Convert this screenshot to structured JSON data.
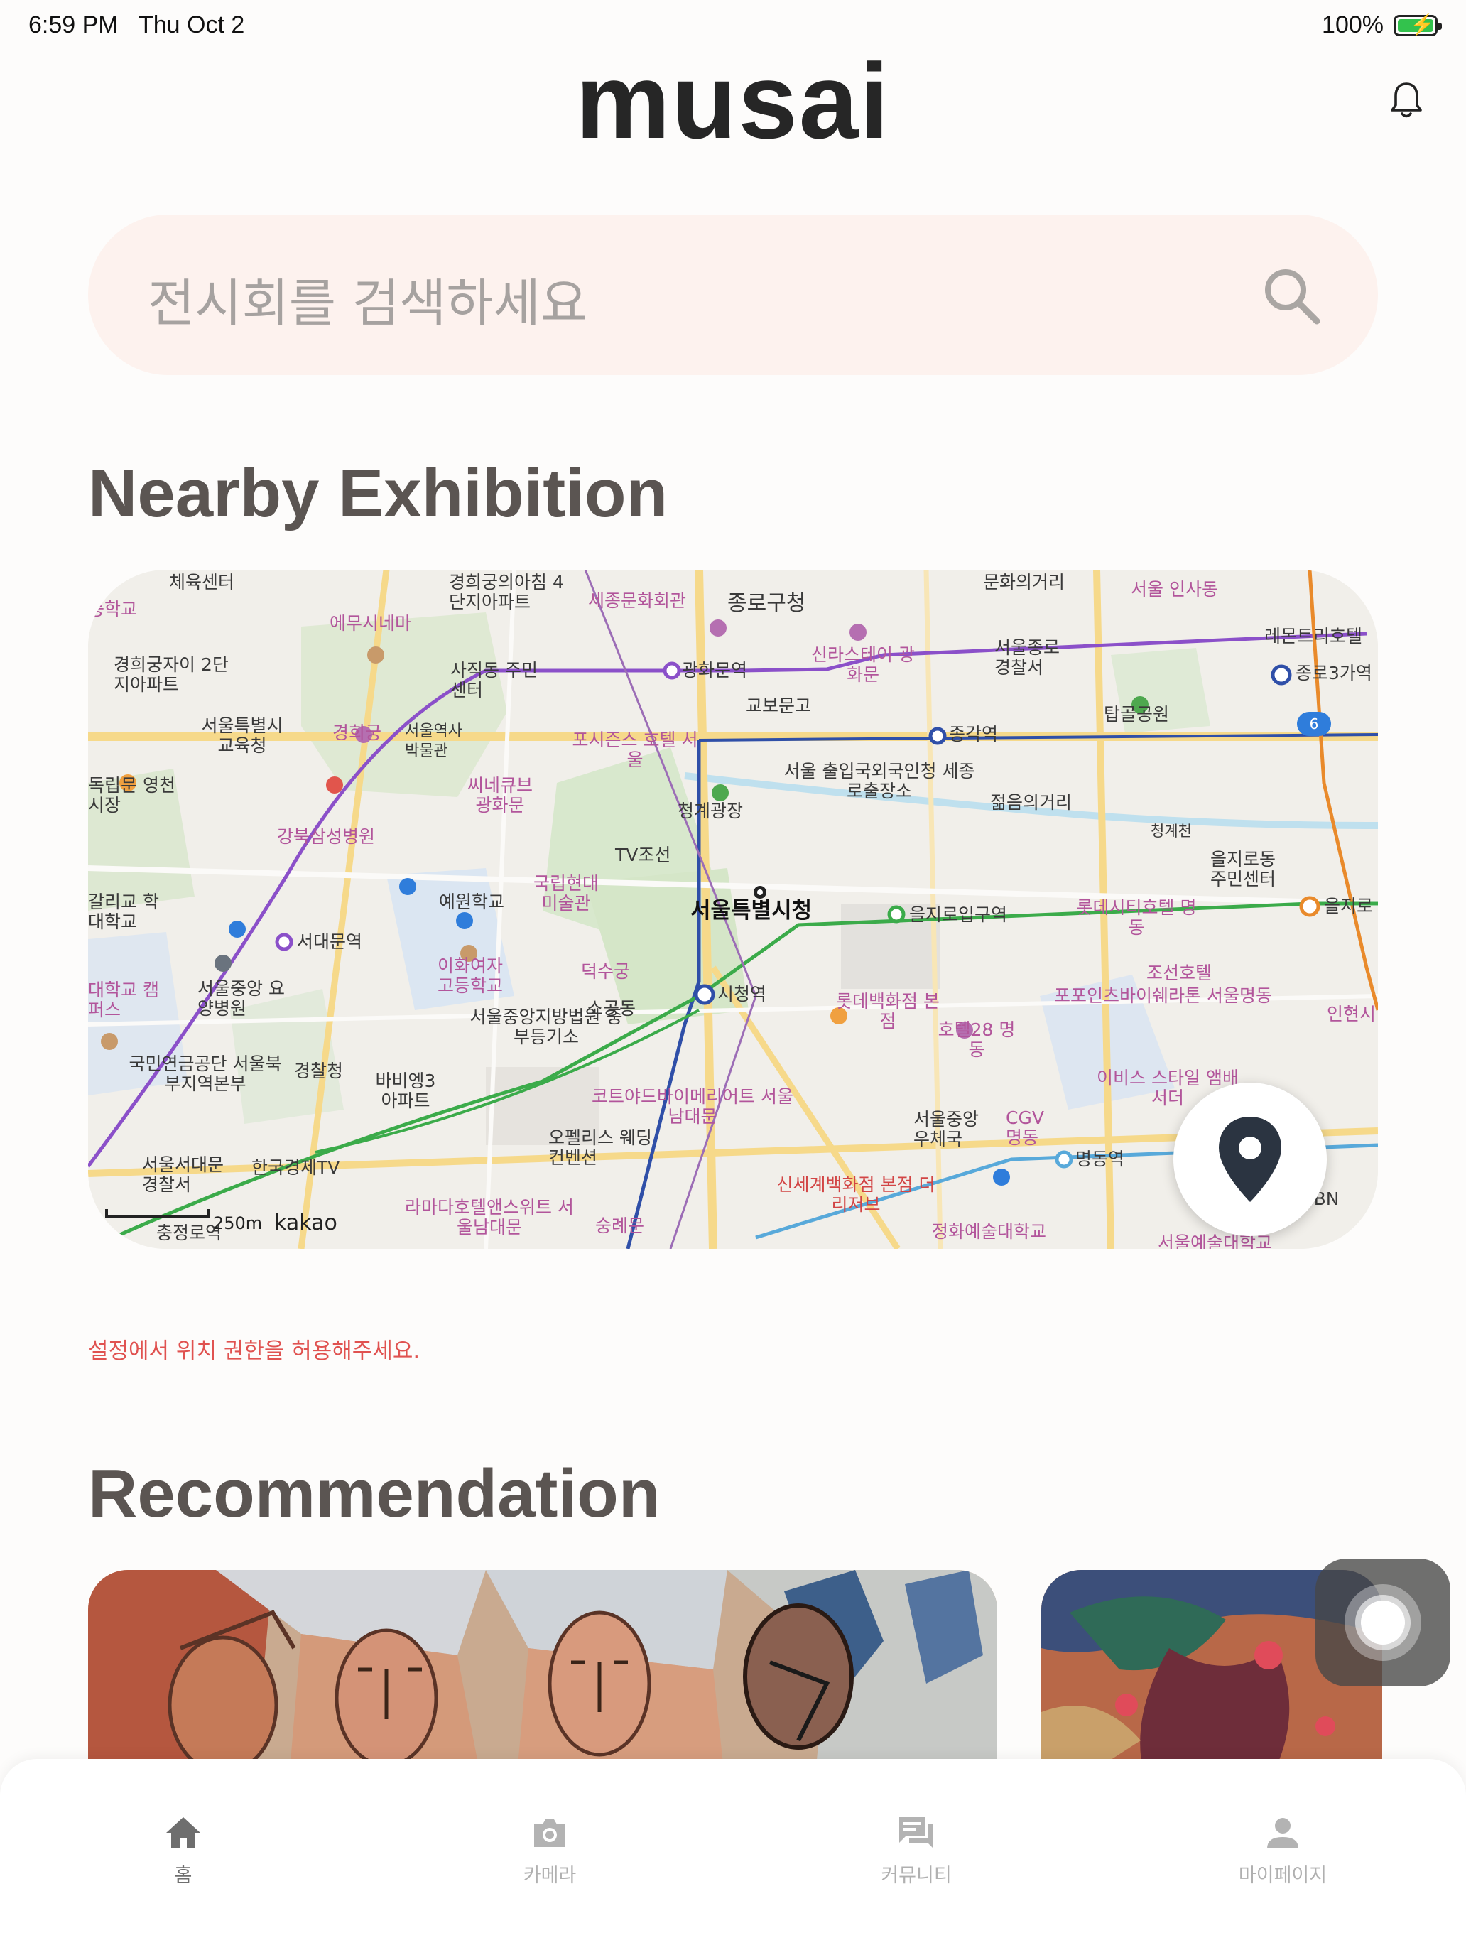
{
  "status_bar": {
    "time": "6:59 PM",
    "date": "Thu Oct 2",
    "battery": "100%"
  },
  "header": {
    "title": "musai"
  },
  "search": {
    "placeholder": "전시회를 검색하세요"
  },
  "nearby": {
    "title": "Nearby Exhibition",
    "map": {
      "provider": "kakao",
      "scale": "250m",
      "labels": [
        "체육센터",
        "경희궁의아침 4단지아파트",
        "세종문화회관",
        "종로구청",
        "문화의거리",
        "서울 인사동",
        "등학교",
        "에무시네마",
        "경희궁자이 2단지아파트",
        "사직동 주민센터",
        "광화문역",
        "신라스테이 광화문",
        "서울종로 경찰서",
        "레몬트리호텔",
        "종로3가역",
        "교보문고",
        "서울특별시 교육청",
        "경희궁",
        "서울역사 박물관",
        "포시즌스 호텔 서울",
        "종각역",
        "탑골공원",
        "독립문 영천시장",
        "씨네큐브 광화문",
        "청계광장",
        "서울 출입국외국인청 세종로출장소",
        "젊음의거리",
        "청계천",
        "강북삼성병원",
        "TV조선",
        "을지로동 주민센터",
        "갈리교 학대학교",
        "예원학교",
        "국립현대 미술관",
        "서울특별시청",
        "을지로입구역",
        "롯데시티호텔 명동",
        "을지로",
        "서대문역",
        "이화여자 고등학교",
        "덕수궁",
        "조선호텔",
        "포포인츠바이쉐라톤 서울명동",
        "대학교 캠퍼스",
        "서울중앙 요양병원",
        "시청역",
        "소공동",
        "롯데백화점 본점",
        "호텔28 명동",
        "인현시",
        "서울중앙지방법원 중부등기소",
        "국민연금공단 서울북부지역본부",
        "경찰청",
        "바비엥3 아파트",
        "코트야드바이메리어트 서울남대문",
        "이비스 스타일 앰배서더",
        "오펠리스 웨딩컨벤션",
        "서울중앙 우체국",
        "CGV 명동",
        "명동역",
        "서울서대문 경찰서",
        "한국경제TV",
        "라마다호텔앤스위트 서울남대문",
        "숭례문",
        "신세계백화점 본점 더 리저브",
        "정화예술대학교",
        "서울예술대학교",
        "충정로역",
        "MBN"
      ]
    }
  },
  "location_warning": "설정에서 위치 권한을 허용해주세요.",
  "recommendation": {
    "title": "Recommendation"
  },
  "tabs": [
    {
      "label": "홈",
      "icon": "home-icon"
    },
    {
      "label": "카메라",
      "icon": "camera-icon"
    },
    {
      "label": "커뮤니티",
      "icon": "chat-icon"
    },
    {
      "label": "마이페이지",
      "icon": "person-icon"
    }
  ],
  "colors": {
    "accent": "#e05250",
    "search_bg": "#fdf2ee",
    "title": "#5b5552",
    "tab_active": "#6e6e6e",
    "tab_inactive": "#b0b0b0"
  }
}
